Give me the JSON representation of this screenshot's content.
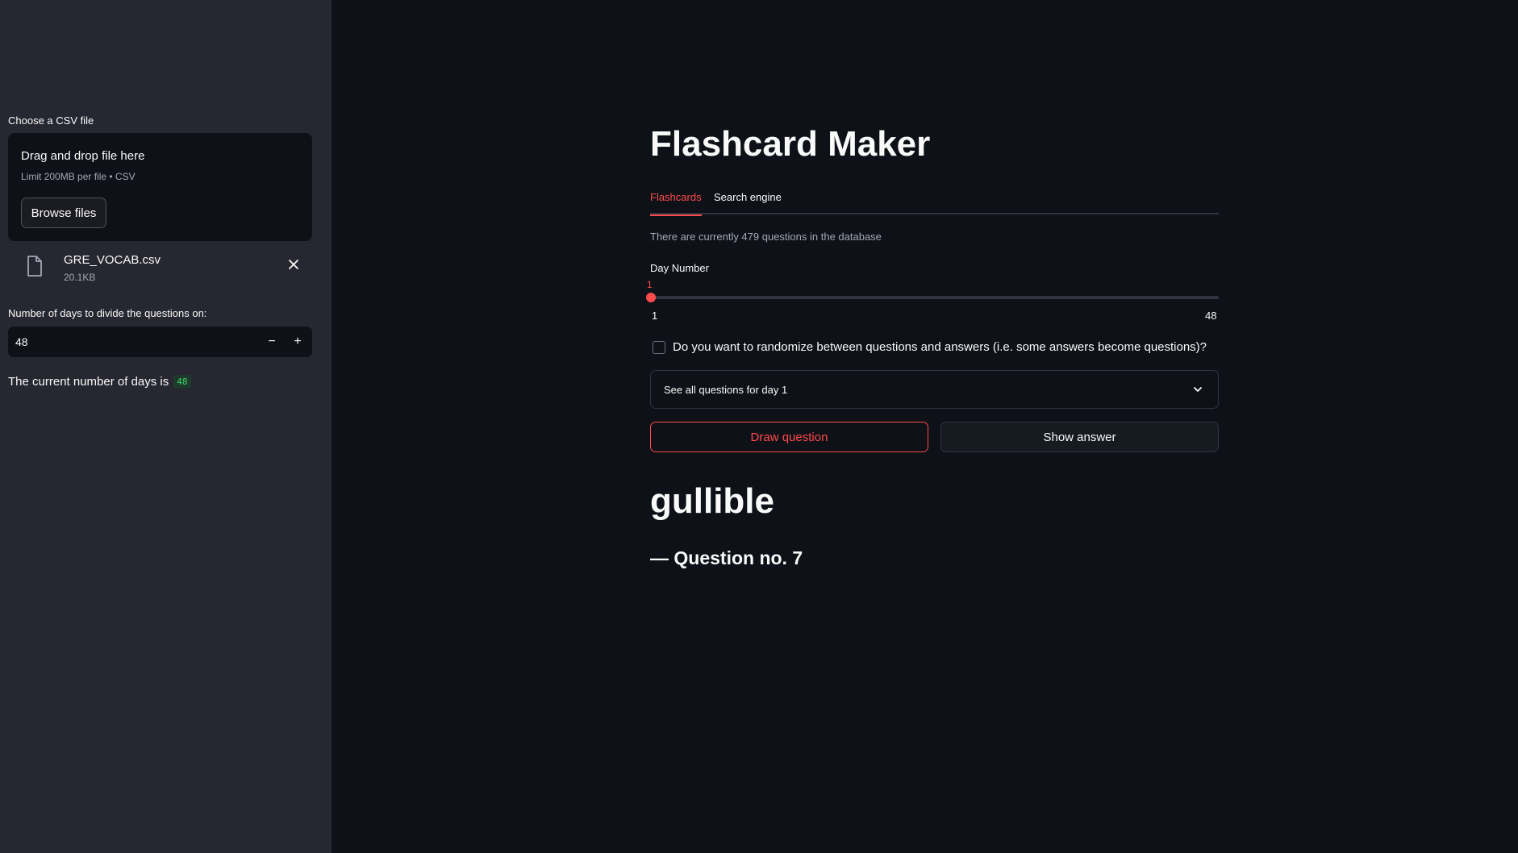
{
  "sidebar": {
    "upload_label": "Choose a CSV file",
    "dropzone": {
      "title": "Drag and drop file here",
      "limit": "Limit 200MB per file • CSV",
      "browse_label": "Browse files"
    },
    "file": {
      "name": "GRE_VOCAB.csv",
      "size": "20.1KB"
    },
    "days_input": {
      "label": "Number of days to divide the questions on:",
      "value": "48",
      "minus": "−",
      "plus": "+"
    },
    "current_days": {
      "text": "The current number of days is",
      "value": "48"
    }
  },
  "main": {
    "title": "Flashcard Maker",
    "tabs": [
      {
        "label": "Flashcards",
        "active": true
      },
      {
        "label": "Search engine",
        "active": false
      }
    ],
    "db_info": "There are currently 479 questions in the database",
    "slider": {
      "label": "Day Number",
      "value": "1",
      "min": "1",
      "max": "48"
    },
    "checkbox_label": "Do you want to randomize between questions and answers (i.e. some answers become questions)?",
    "expander_label": "See all questions for day 1",
    "draw_button": "Draw question",
    "show_button": "Show answer",
    "word": "gullible",
    "question_no": "— Question no. 7"
  },
  "colors": {
    "accent": "#ff4b4b",
    "background": "#0e1117",
    "sidebar": "#262730",
    "badge_text": "#3dd56d"
  }
}
